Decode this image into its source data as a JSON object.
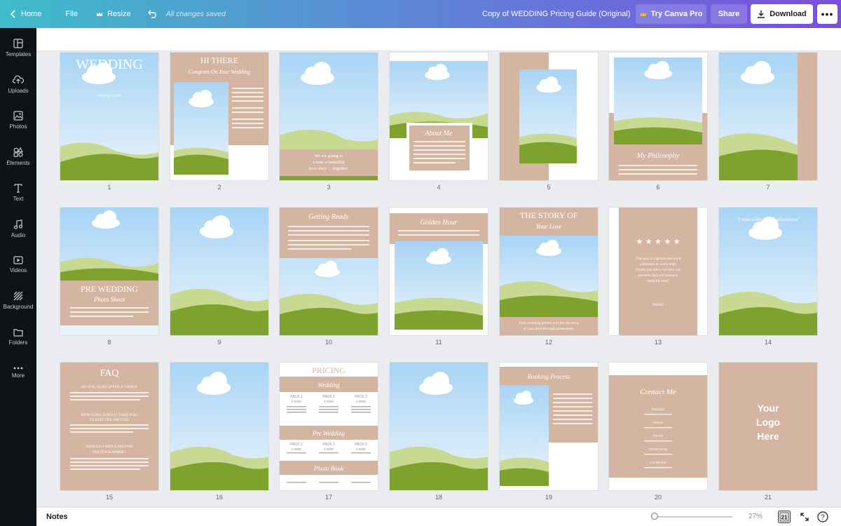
{
  "topbar": {
    "home_label": "Home",
    "file_label": "File",
    "resize_label": "Resize",
    "save_status": "All changes saved",
    "document_title": "Copy of WEDDING Pricing Guide (Original)",
    "try_pro_label": "Try Canva Pro",
    "share_label": "Share",
    "download_label": "Download",
    "more_label": "•••"
  },
  "sidebar": {
    "items": [
      {
        "label": "Templates",
        "icon": "templates-icon"
      },
      {
        "label": "Uploads",
        "icon": "uploads-icon"
      },
      {
        "label": "Photos",
        "icon": "photos-icon"
      },
      {
        "label": "Elements",
        "icon": "elements-icon"
      },
      {
        "label": "Text",
        "icon": "text-icon"
      },
      {
        "label": "Audio",
        "icon": "audio-icon"
      },
      {
        "label": "Videos",
        "icon": "videos-icon"
      },
      {
        "label": "Background",
        "icon": "background-icon"
      },
      {
        "label": "Folders",
        "icon": "folders-icon"
      },
      {
        "label": "More",
        "icon": "more-icon"
      }
    ]
  },
  "pages": [
    {
      "num": "1",
      "texts": [
        "WEDDING",
        "Pricing Guide"
      ]
    },
    {
      "num": "2",
      "texts": [
        "HI THERE",
        "Congrats On Your Wedding"
      ]
    },
    {
      "num": "3",
      "texts": [
        "We are going to",
        "create a beautiful",
        "love story ... together."
      ]
    },
    {
      "num": "4",
      "texts": [
        "About Me"
      ]
    },
    {
      "num": "5",
      "texts": []
    },
    {
      "num": "6",
      "texts": [
        "My Philosophy"
      ]
    },
    {
      "num": "7",
      "texts": []
    },
    {
      "num": "8",
      "texts": [
        "PRE WEDDING",
        "Photo Shoot"
      ]
    },
    {
      "num": "9",
      "texts": []
    },
    {
      "num": "10",
      "texts": [
        "Getting Ready"
      ]
    },
    {
      "num": "11",
      "texts": [
        "Golden Hour"
      ]
    },
    {
      "num": "12",
      "texts": [
        "THE STORY OF",
        "Your Love",
        "Your wedding photos will tell the story",
        "of your love through generations."
      ]
    },
    {
      "num": "13",
      "texts": [
        "★ ★ ★ ★ ★",
        "This guy is a genius and such",
        "a pleasure to work with.",
        "Thank you Alex, we love our",
        "pictures and will treasure",
        "them for ever!",
        "NIKKI"
      ]
    },
    {
      "num": "14",
      "texts": [
        "\"I want a life full of adventures\""
      ]
    },
    {
      "num": "15",
      "texts": [
        "FAQ",
        "DO YOU ALSO OFFER A VIDEO?",
        "HOW LONG DOES IT TAKE YOU",
        "TO EDIT THE PHOTOS?",
        "SHOULD I ADD A SECOND",
        "PHOTOGRAPHER?"
      ]
    },
    {
      "num": "16",
      "texts": []
    },
    {
      "num": "17",
      "texts": [
        "PRICING",
        "Wedding",
        "PACK 1",
        "PACK 2",
        "PACK 3",
        "€ 0000",
        "€ 0000",
        "€ 0000",
        "Pre Wedding",
        "PACK 1",
        "PACK 2",
        "PACK 3",
        "€ 0000",
        "€ 0000",
        "€ 0000",
        "Photo Book"
      ]
    },
    {
      "num": "18",
      "texts": []
    },
    {
      "num": "19",
      "texts": [
        "Booking Process"
      ]
    },
    {
      "num": "20",
      "texts": [
        "Contact Me",
        "WEBSITE",
        "EMAIL",
        "PHONE",
        "INSTAGRAM",
        "FACEBOOK"
      ]
    },
    {
      "num": "21",
      "texts": [
        "Your",
        "Logo",
        "Here"
      ]
    }
  ],
  "bottombar": {
    "notes_label": "Notes",
    "zoom_label": "27%",
    "zoom_fraction": 0.27,
    "grid_view_label": "21",
    "help_label": "?"
  },
  "colors": {
    "sky_top": "#a8d4f5",
    "sky_bottom": "#eaf4fb",
    "grass_light": "#c8d991",
    "grass_dark": "#7ea22e",
    "tan": "#d4b5a2",
    "sidebar_bg": "#0e1318"
  }
}
